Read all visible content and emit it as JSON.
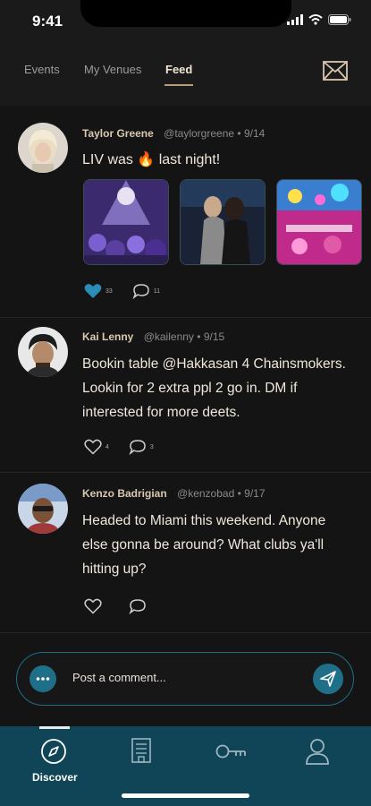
{
  "status_bar": {
    "time": "9:41"
  },
  "tabs": [
    {
      "label": "Events"
    },
    {
      "label": "My Venues"
    },
    {
      "label": "Feed",
      "active": true
    }
  ],
  "posts": [
    {
      "name": "Taylor Greene",
      "handle": "@taylorgreene",
      "separator": "•",
      "date": "9/14",
      "text": "LIV was 🔥 last night!",
      "photos": [
        "nightclub-crowd-photo",
        "dancing-couple-photo",
        "pink-venue-photo"
      ],
      "likes": "33",
      "comments": "11",
      "liked": true
    },
    {
      "name": "Kai Lenny",
      "handle": "@kailenny",
      "separator": "•",
      "date": "9/15",
      "text": "Bookin table @Hakkasan 4 Chainsmokers. Lookin for 2 extra ppl 2 go in. DM if interested for more deets.",
      "likes": "4",
      "comments": "3",
      "liked": false
    },
    {
      "name": "Kenzo Badrigian",
      "handle": "@kenzobad",
      "separator": "•",
      "date": "9/17",
      "text": "Headed to Miami this weekend. Anyone else gonna be around? What clubs ya'll hitting up?",
      "liked": false
    }
  ],
  "comment": {
    "placeholder": "Post a comment..."
  },
  "bottom_nav": [
    {
      "label": "Discover",
      "icon": "compass-icon",
      "active": true
    },
    {
      "label": "",
      "icon": "building-icon"
    },
    {
      "label": "",
      "icon": "key-icon"
    },
    {
      "label": "",
      "icon": "user-icon"
    }
  ],
  "colors": {
    "background": "#141414",
    "accent": "#1f6f88",
    "nav_bar": "#0f4557",
    "name_text": "#d9c8b0",
    "like_active": "#2a8db8"
  }
}
